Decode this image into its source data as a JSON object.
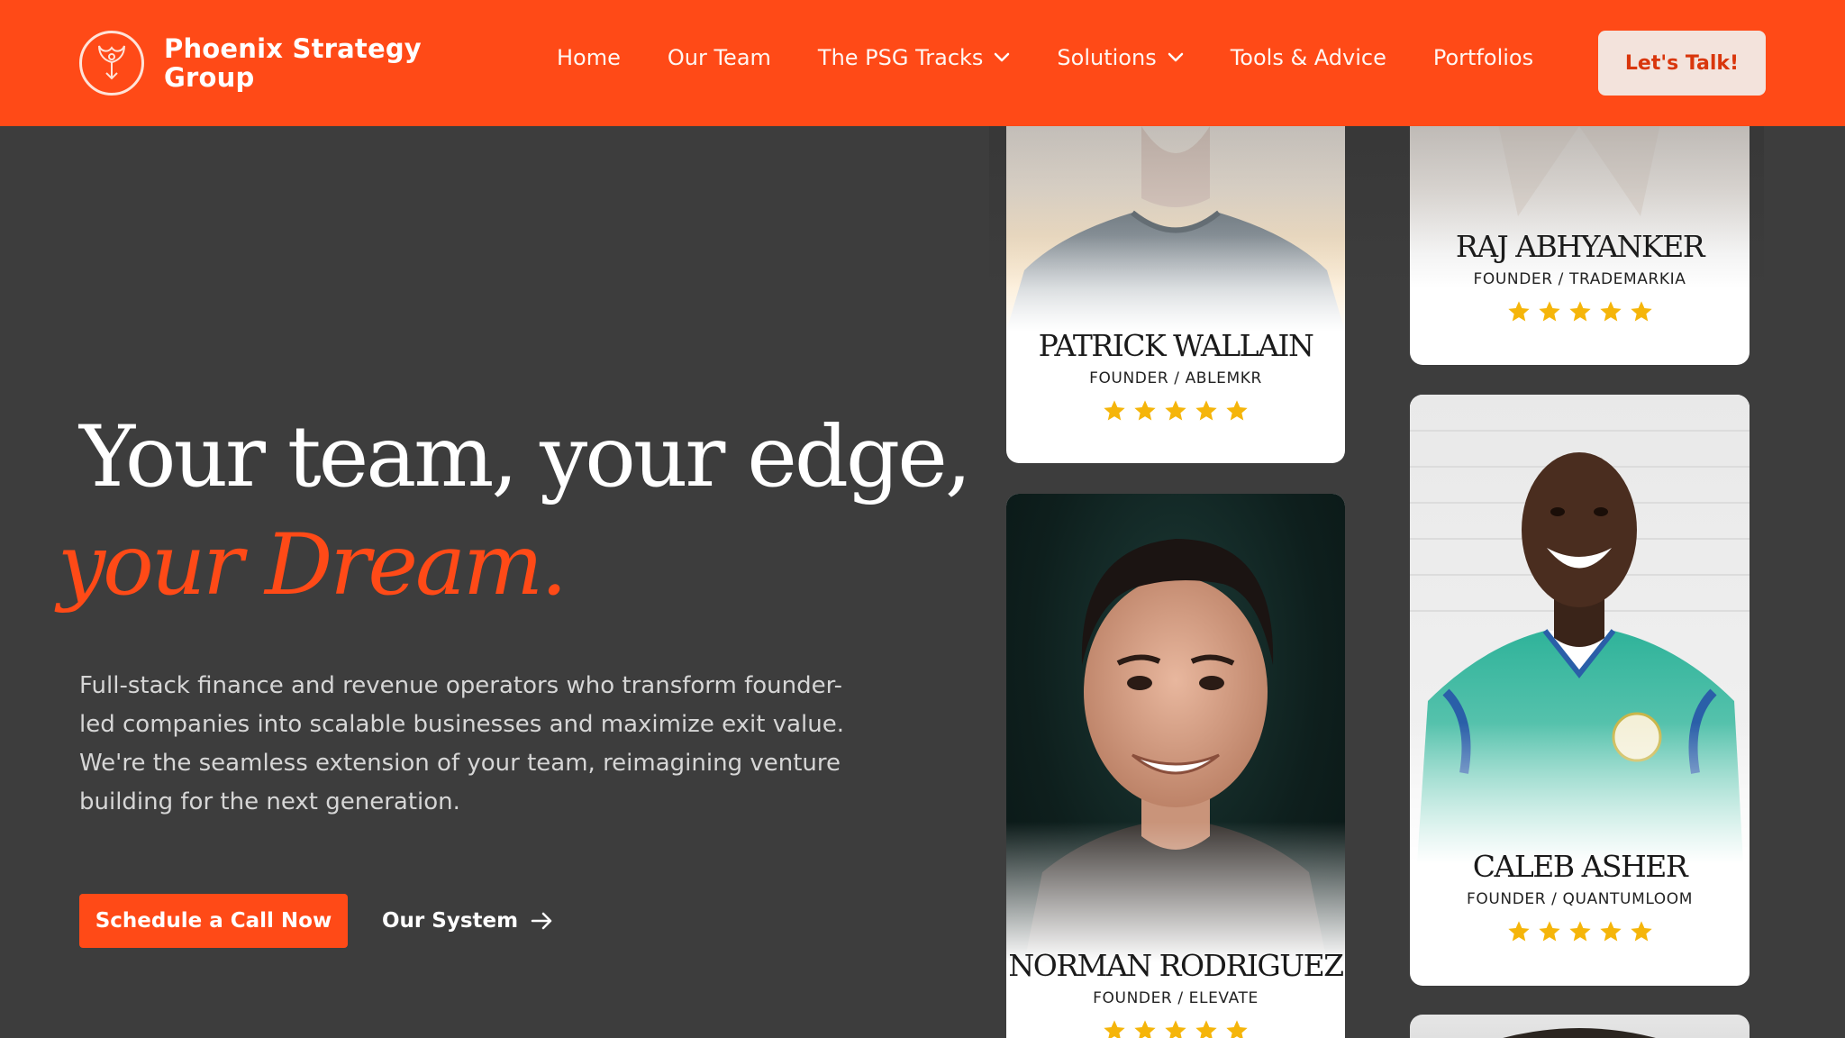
{
  "brand": {
    "name_line1": "Phoenix Strategy",
    "name_line2": "Group",
    "logo_icon": "phoenix-icon"
  },
  "nav": {
    "items": [
      {
        "label": "Home",
        "dropdown": false
      },
      {
        "label": "Our Team",
        "dropdown": false
      },
      {
        "label": "The PSG Tracks",
        "dropdown": true
      },
      {
        "label": "Solutions",
        "dropdown": true
      },
      {
        "label": "Tools & Advice",
        "dropdown": false
      },
      {
        "label": "Portfolios",
        "dropdown": false
      }
    ],
    "cta_label": "Let's Talk!"
  },
  "hero": {
    "title": "Your team, your edge,",
    "subtitle": "your Dream.",
    "description": "Full-stack finance and revenue operators who transform founder-led companies into scalable businesses and maximize exit value. We're the seamless extension of your team, reimagining venture building for the next generation.",
    "primary_button": "Schedule a Call Now",
    "secondary_button": "Our System"
  },
  "testimonials": [
    {
      "name": "PATRICK WALLAIN",
      "role": "FOUNDER / ABLEMKR",
      "rating": 5
    },
    {
      "name": "RAJ ABHYANKER",
      "role": "FOUNDER / TRADEMARKIA",
      "rating": 5
    },
    {
      "name": "NORMAN RODRIGUEZ",
      "role": "FOUNDER / ELEVATE",
      "rating": 5
    },
    {
      "name": "CALEB ASHER",
      "role": "FOUNDER / QUANTUMLOOM",
      "rating": 5
    }
  ],
  "colors": {
    "accent": "#ff4a17",
    "background": "#3d3d3d",
    "star": "#f5b50a",
    "cta_bg": "#f3e3dc"
  }
}
